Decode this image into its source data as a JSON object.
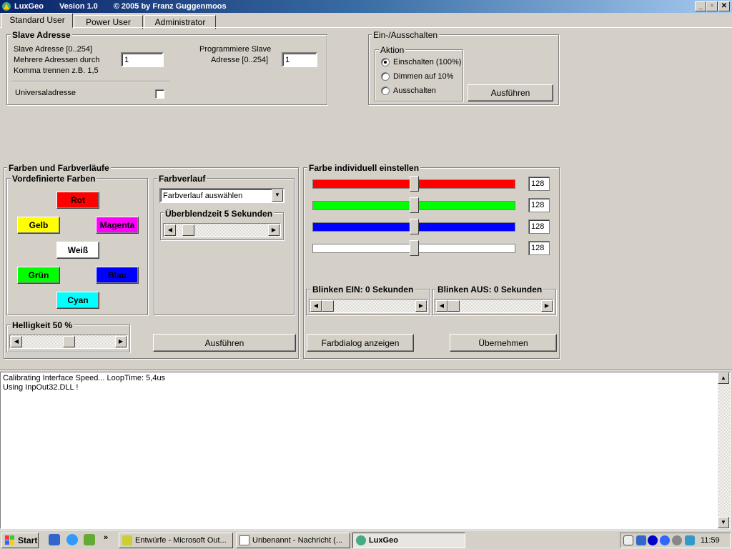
{
  "window": {
    "title": "LuxGeo",
    "version": "Vesion 1.0",
    "copyright": "© 2005 by Franz Guggenmoos",
    "min": "_",
    "restore": "▫",
    "close": "✕"
  },
  "tabs": [
    {
      "label": "Standard User"
    },
    {
      "label": "Power User"
    },
    {
      "label": "Administrator"
    }
  ],
  "slave": {
    "group_title": "Slave Adresse",
    "range_label": "Slave Adresse [0..254]",
    "multi_label1": "Mehrere Adressen durch",
    "multi_label2": "Komma trennen z.B. 1,5",
    "address_value": "1",
    "prog_label1": "Programmiere Slave",
    "prog_label2": "Adresse [0..254]",
    "prog_value": "1",
    "universal_label": "Universaladresse",
    "universal_checked": false
  },
  "onoff": {
    "group_title": "Ein-/Ausschalten",
    "action_title": "Aktion",
    "options": [
      "Einschalten (100%)",
      "Dimmen auf 10%",
      "Ausschalten"
    ],
    "selected": 0,
    "execute": "Ausführen"
  },
  "colors": {
    "group_title": "Farben und Farbverläufe",
    "predef_title": "Vordefinierte Farben",
    "buttons": [
      {
        "label": "Rot",
        "color": "#ff0000"
      },
      {
        "label": "Gelb",
        "color": "#ffff00"
      },
      {
        "label": "Magenta",
        "color": "#ff00ff"
      },
      {
        "label": "Weiß",
        "color": "#ffffff"
      },
      {
        "label": "Grün",
        "color": "#00ff00"
      },
      {
        "label": "Blau",
        "color": "#0000ff"
      },
      {
        "label": "Cyan",
        "color": "#00ffff"
      }
    ],
    "gradient_title": "Farbverlauf",
    "gradient_select": "Farbverlauf auswählen",
    "fade_title": "Überblendzeit 5 Sekunden",
    "fade_level": 0.13,
    "brightness_title": "Helligkeit 50 %",
    "brightness_level": 0.5,
    "execute": "Ausführen"
  },
  "individual": {
    "group_title": "Farbe individuell einstellen",
    "sliders": [
      {
        "name": "red",
        "color": "#ff0000",
        "value": "128",
        "level": 0.5
      },
      {
        "name": "green",
        "color": "#00ff00",
        "value": "128",
        "level": 0.5
      },
      {
        "name": "blue",
        "color": "#0000ff",
        "value": "128",
        "level": 0.5
      },
      {
        "name": "white",
        "color": "#ffffff",
        "value": "128",
        "level": 0.5
      }
    ],
    "blink_on_title": "Blinken EIN: 0 Sekunden",
    "blink_on_level": 0,
    "blink_off_title": "Blinken AUS: 0 Sekunden",
    "blink_off_level": 0,
    "dialog_button": "Farbdialog anzeigen",
    "apply_button": "Übernehmen"
  },
  "log": {
    "lines": [
      "Calibrating Interface Speed...   LoopTime: 5,4us",
      "Using InpOut32.DLL !"
    ]
  },
  "taskbar": {
    "start": "Start",
    "chevron": "»",
    "tasks": [
      "Entwürfe - Microsoft Out...",
      "Unbenannt - Nachricht (...",
      "LuxGeo"
    ],
    "clock": "11:59"
  }
}
